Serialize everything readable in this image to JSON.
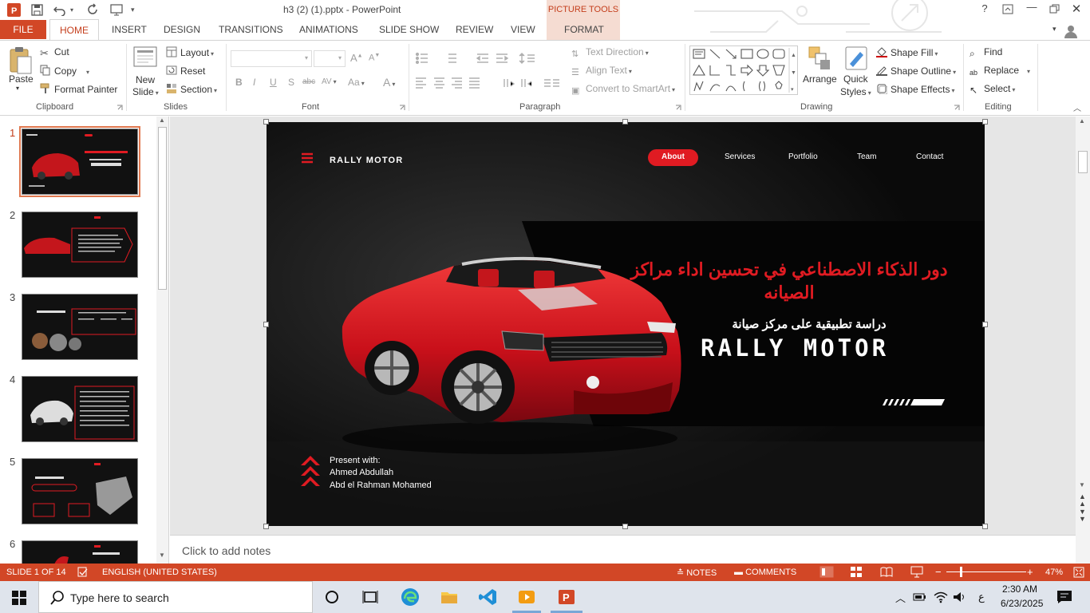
{
  "window": {
    "title": "h3 (2) (1).pptx - PowerPoint",
    "contextual_tab_group": "PICTURE TOOLS"
  },
  "tabs": [
    "FILE",
    "HOME",
    "INSERT",
    "DESIGN",
    "TRANSITIONS",
    "ANIMATIONS",
    "SLIDE SHOW",
    "REVIEW",
    "VIEW",
    "FORMAT"
  ],
  "ribbon": {
    "clipboard": {
      "paste": "Paste",
      "cut": "Cut",
      "copy": "Copy",
      "format_painter": "Format Painter",
      "label": "Clipboard"
    },
    "slides": {
      "new_slide_1": "New",
      "new_slide_2": "Slide",
      "layout": "Layout",
      "reset": "Reset",
      "section": "Section",
      "label": "Slides"
    },
    "font": {
      "bold": "B",
      "italic": "I",
      "underline": "U",
      "shadow": "S",
      "strike": "abc",
      "label": "Font"
    },
    "paragraph": {
      "text_direction": "Text Direction",
      "align_text": "Align Text",
      "convert_smartart": "Convert to SmartArt",
      "label": "Paragraph"
    },
    "drawing": {
      "arrange": "Arrange",
      "quick_1": "Quick",
      "quick_2": "Styles",
      "shape_fill": "Shape Fill",
      "shape_outline": "Shape Outline",
      "shape_effects": "Shape Effects",
      "label": "Drawing"
    },
    "editing": {
      "find": "Find",
      "replace": "Replace",
      "select": "Select",
      "label": "Editing"
    }
  },
  "thumbnails": [
    {
      "num": "1"
    },
    {
      "num": "2"
    },
    {
      "num": "3"
    },
    {
      "num": "4"
    },
    {
      "num": "5"
    },
    {
      "num": "6"
    }
  ],
  "slide": {
    "brand": "RALLY MOTOR",
    "nav": [
      "About",
      "Services",
      "Portfolio",
      "Team",
      "Contact"
    ],
    "title_ar": "دور الذكاء الاصطناعي  في تحسين اداء مراكز الصيانه",
    "subtitle_ar": "دراسة تطبيقية على مركز صيانة",
    "big_brand": "RALLY MOTOR",
    "present_label": "Present with:",
    "presenter_1": "Ahmed Abdullah",
    "presenter_2": "Abd el Rahman Mohamed",
    "colors": {
      "accent": "#e01b22",
      "bg": "#0b0b0b"
    }
  },
  "notes_placeholder": "Click to add notes",
  "statusbar": {
    "slide_info": "SLIDE 1 OF 14",
    "language": "ENGLISH (UNITED STATES)",
    "notes": "NOTES",
    "comments": "COMMENTS",
    "zoom": "47%"
  },
  "taskbar": {
    "search_placeholder": "Type here to search",
    "time": "2:30 AM",
    "date": "6/23/2025",
    "lang": "ع"
  }
}
